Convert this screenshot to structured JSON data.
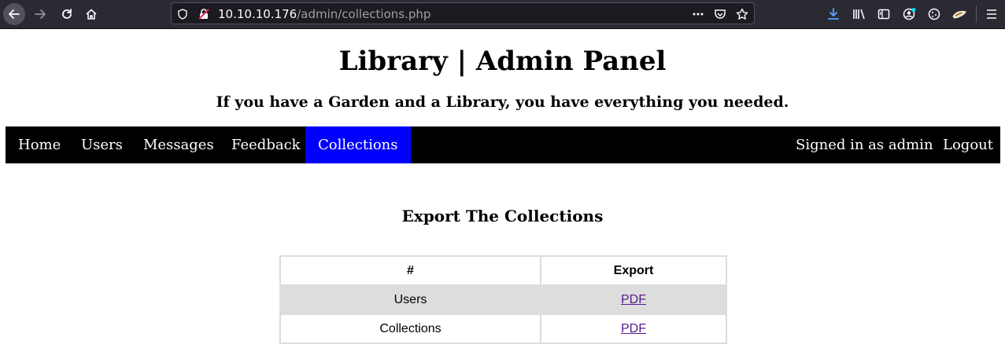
{
  "browser": {
    "url_host": "10.10.10.176",
    "url_path": "/admin/collections.php"
  },
  "header": {
    "title": "Library | Admin Panel",
    "subtitle": "If you have a Garden and a Library, you have everything you needed."
  },
  "nav": {
    "items": [
      {
        "label": "Home"
      },
      {
        "label": "Users"
      },
      {
        "label": "Messages"
      },
      {
        "label": "Feedback"
      },
      {
        "label": "Collections",
        "active": true
      }
    ],
    "signed_in": "Signed in as admin",
    "logout": "Logout",
    "active_color": "#0000ff"
  },
  "main": {
    "section_title": "Export The Collections",
    "table": {
      "headers": [
        "#",
        "Export"
      ],
      "rows": [
        {
          "name": "Users",
          "export": "PDF"
        },
        {
          "name": "Collections",
          "export": "PDF"
        }
      ]
    }
  }
}
